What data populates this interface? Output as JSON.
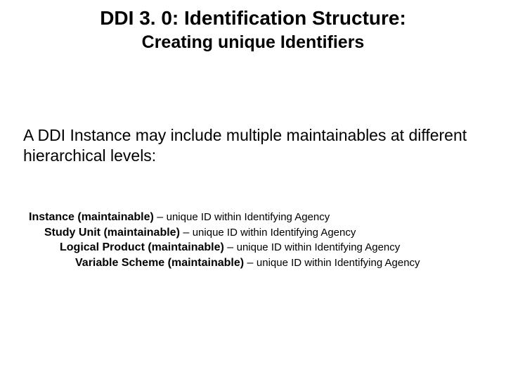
{
  "title": "DDI 3. 0: Identification Structure:",
  "subtitle": "Creating unique Identifiers",
  "intro": "A DDI Instance may include multiple maintainables at different hierarchical levels:",
  "hierarchy": [
    {
      "label": "Instance (maintainable)",
      "dash": " – ",
      "desc": "unique ID within Identifying Agency"
    },
    {
      "label": "Study Unit (maintainable)",
      "dash": " – ",
      "desc": "unique ID within Identifying Agency"
    },
    {
      "label": "Logical Product (maintainable)",
      "dash": " – ",
      "desc": "unique ID within Identifying Agency"
    },
    {
      "label": "Variable Scheme (maintainable)",
      "dash": " – ",
      "desc": "unique ID within Identifying Agency"
    }
  ]
}
